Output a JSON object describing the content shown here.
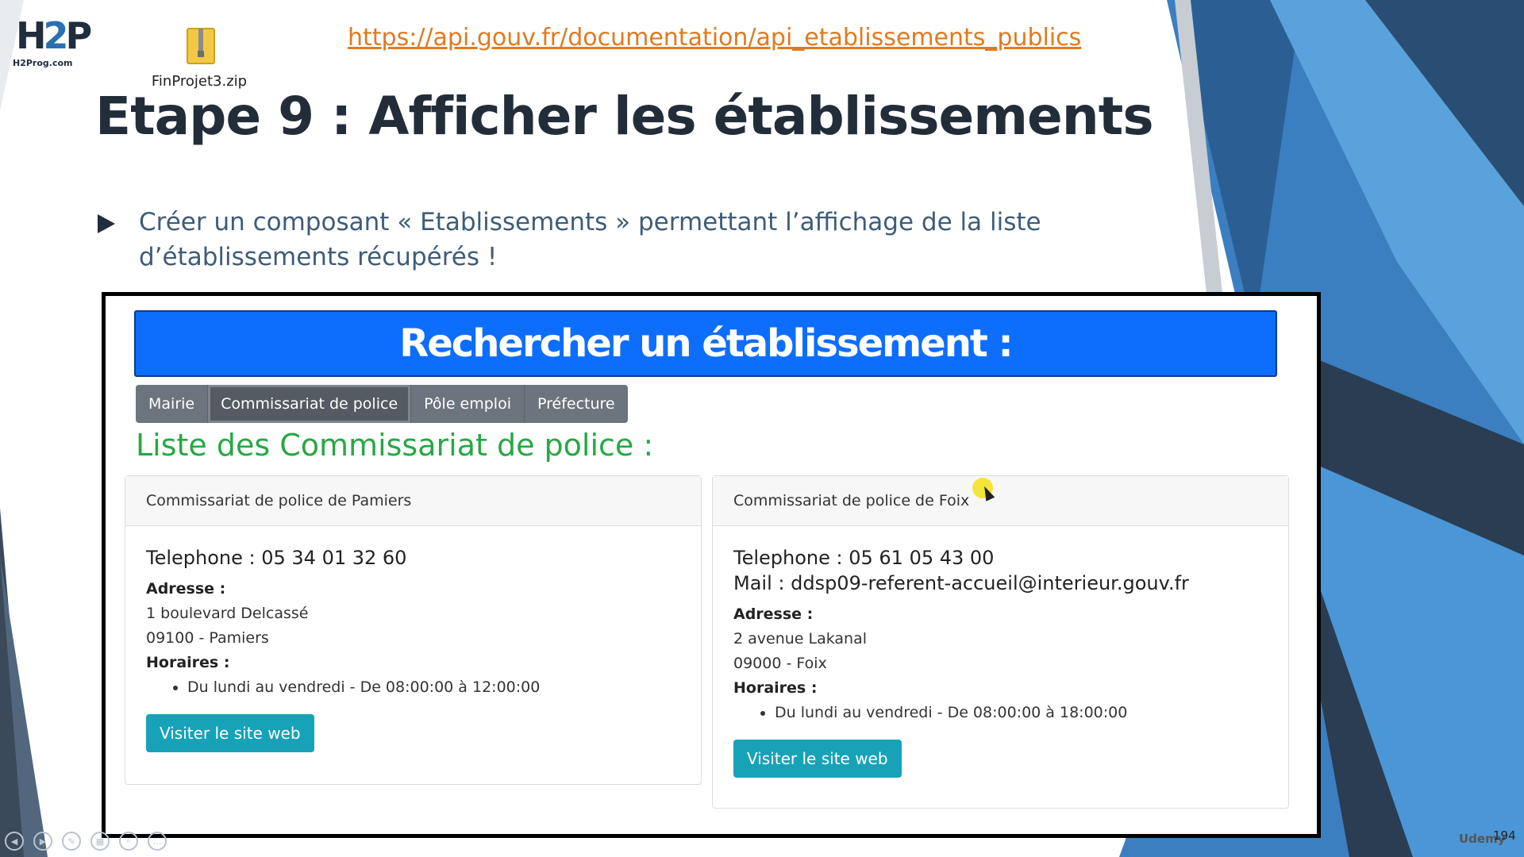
{
  "logo": {
    "mark_a": "H",
    "mark_b": "2",
    "mark_c": "P",
    "sub": "H2Prog.com"
  },
  "zip": {
    "label": "FinProjet3.zip",
    "icon": "zip-file-icon"
  },
  "link": "https://api.gouv.fr/documentation/api_etablissements_publics",
  "title": "Etape 9 : Afficher les établissements",
  "bullet": "Créer un composant « Etablissements » permettant l’affichage de la liste d’établissements récupérés !",
  "app": {
    "banner": "Rechercher un établissement :",
    "tabs": [
      {
        "label": "Mairie"
      },
      {
        "label": "Commissariat de police",
        "active": true
      },
      {
        "label": "Pôle emploi"
      },
      {
        "label": "Préfecture"
      }
    ],
    "list_title": "Liste des Commissariat de police :",
    "cards": [
      {
        "header": "Commissariat de police de Pamiers",
        "phone": "Telephone : 05 34 01 32 60",
        "address_label": "Adresse :",
        "address_line1": "1 boulevard Delcassé",
        "address_line2": "09100 - Pamiers",
        "hours_label": "Horaires :",
        "hours": "Du lundi au vendredi - De 08:00:00 à 12:00:00",
        "button": "Visiter le site web"
      },
      {
        "header": "Commissariat de police de Foix",
        "phone": "Telephone : 05 61 05 43 00",
        "mail": "Mail : ddsp09-referent-accueil@interieur.gouv.fr",
        "address_label": "Adresse :",
        "address_line1": "2 avenue Lakanal",
        "address_line2": "09000 - Foix",
        "hours_label": "Horaires :",
        "hours": "Du lundi au vendredi - De 08:00:00 à 18:00:00",
        "button": "Visiter le site web"
      }
    ]
  },
  "footer": {
    "page": "194",
    "brand": "Udemy"
  },
  "colors": {
    "banner": "#0d6efd",
    "tab": "#6c757d",
    "list_title": "#28a745",
    "button": "#17a2b8",
    "link": "#e07a1f",
    "bullet_text": "#3e5c77"
  }
}
